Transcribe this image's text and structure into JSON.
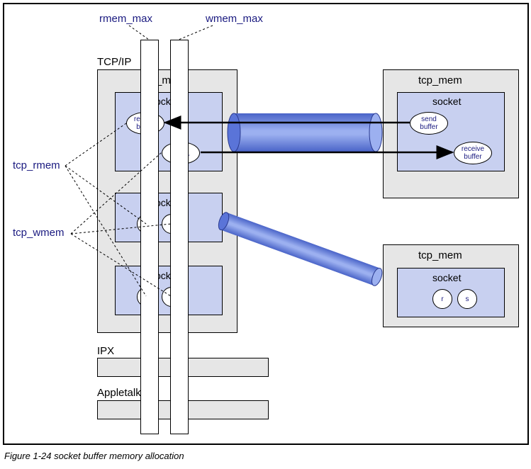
{
  "annotations": {
    "rmem_max": "rmem_max",
    "wmem_max": "wmem_max",
    "tcp_rmem": "tcp_rmem",
    "tcp_wmem": "tcp_wmem"
  },
  "protocols": {
    "tcpip": "TCP/IP",
    "ipx": "IPX",
    "appletalk": "Appletalk"
  },
  "tcp_mem_label": "tcp_mem",
  "socket_label": "socket",
  "buffers": {
    "receive": "receive\nbuffer",
    "send": "send\nbuffer",
    "r": "r",
    "s": "s"
  },
  "caption": "Figure 1-24   socket buffer memory allocation"
}
